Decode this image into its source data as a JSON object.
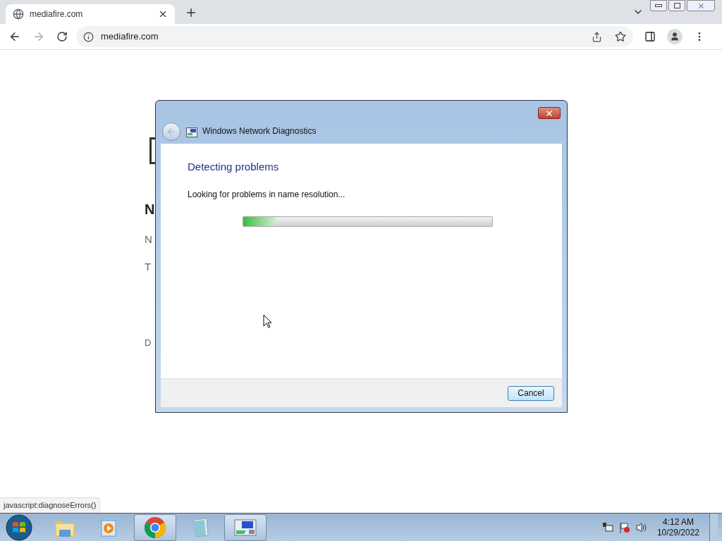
{
  "browser": {
    "tab": {
      "title": "mediafire.com"
    },
    "address": "mediafire.com"
  },
  "page": {
    "fragments": [
      {
        "kind": "heading",
        "text": "N"
      },
      {
        "kind": "text",
        "text": "N"
      },
      {
        "kind": "text",
        "text": "T"
      },
      {
        "kind": "small",
        "text": "D"
      }
    ]
  },
  "dialog": {
    "title": "Windows Network Diagnostics",
    "heading": "Detecting problems",
    "status": "Looking for problems in name resolution...",
    "progress": {
      "level": 0.13
    },
    "buttons": [
      "Cancel"
    ]
  },
  "status_link": "javascript:diagnoseErrors()",
  "taskbar": {
    "apps": [
      {
        "kind": "explorer",
        "running": false
      },
      {
        "kind": "media",
        "running": false
      },
      {
        "kind": "chrome",
        "running": true
      },
      {
        "kind": "notepad",
        "running": false
      },
      {
        "kind": "network",
        "running": true
      }
    ],
    "clock": {
      "time": "4:12 AM",
      "date": "10/29/2022"
    }
  }
}
